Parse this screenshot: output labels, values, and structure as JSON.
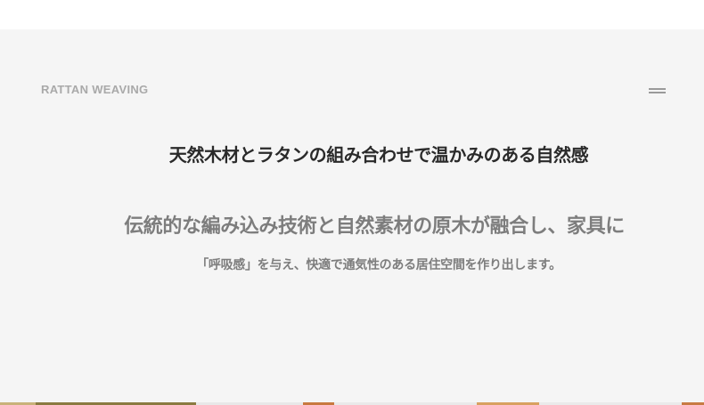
{
  "header": {
    "brand": "RATTAN WEAVING",
    "menu_icon": "hamburger-menu-icon"
  },
  "main": {
    "headline": "天然木材とラタンの組み合わせで温かみのある自然感",
    "lead": "伝統的な編み込み技術と自然素材の原木が融合し、家具に",
    "sub": "「呼吸感」を与え、快適で通気性のある居住空間を作り出します。"
  },
  "colors": {
    "section_background": "#f5f5f5",
    "brand_text": "#a9a9a9",
    "headline_text": "#2a2a2a",
    "body_text": "#7d7d7d"
  }
}
